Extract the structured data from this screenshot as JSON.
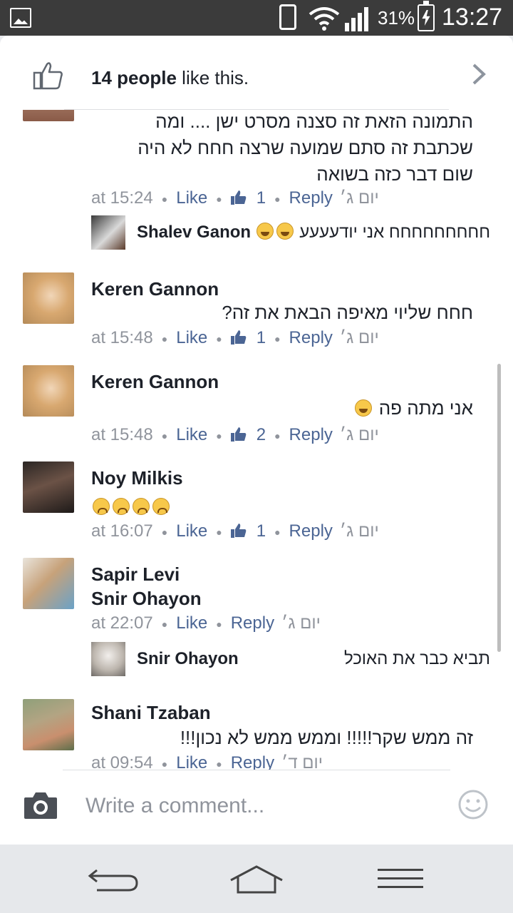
{
  "status_bar": {
    "battery": "31%",
    "time": "13:27"
  },
  "likes": {
    "count_text": "14 people",
    "suffix": " like this."
  },
  "comments": [
    {
      "text_lines": [
        "התמונה הזאת זה סצנה מסרט ישן .... ומה",
        "שכתבת זה סתם שמועה שרצה חחח לא היה",
        "שום דבר כזה בשואה"
      ],
      "time": "at 15:24",
      "like": "Like",
      "like_count": "1",
      "reply": "Reply",
      "day": "יום ג׳",
      "reply_item": {
        "name": "Shalev Ganon",
        "text": "חחחחחחחחח אני יודעעעע"
      }
    },
    {
      "name": "Keren Gannon",
      "text": "חחח שליוי מאיפה הבאת את זה?",
      "time": "at 15:48",
      "like": "Like",
      "like_count": "1",
      "reply": "Reply",
      "day": "יום ג׳"
    },
    {
      "name": "Keren Gannon",
      "text": "אני מתה פה",
      "time": "at 15:48",
      "like": "Like",
      "like_count": "2",
      "reply": "Reply",
      "day": "יום ג׳"
    },
    {
      "name": "Noy Milkis",
      "time": "at 16:07",
      "like": "Like",
      "like_count": "1",
      "reply": "Reply",
      "day": "יום ג׳"
    },
    {
      "name": "Sapir Levi",
      "tag": "Snir Ohayon",
      "time": "at 22:07",
      "like": "Like",
      "reply": "Reply",
      "day": "יום ג׳",
      "reply_item": {
        "name": "Snir Ohayon",
        "text": "תביא כבר את האוכל"
      }
    },
    {
      "name": "Shani Tzaban",
      "text": "זה ממש שקר!!!!! וממש ממש לא נכון!!!",
      "time": "at 09:54",
      "like": "Like",
      "reply": "Reply",
      "day": "יום ד׳"
    }
  ],
  "compose": {
    "placeholder": "Write a comment..."
  },
  "colors": {
    "link": "#4b6594",
    "meta": "#90949c",
    "text": "#1d2129"
  },
  "icons": [
    "thumbs-up-icon",
    "chevron-right-icon",
    "camera-icon",
    "smiley-icon",
    "back-icon",
    "home-icon",
    "menu-icon"
  ]
}
